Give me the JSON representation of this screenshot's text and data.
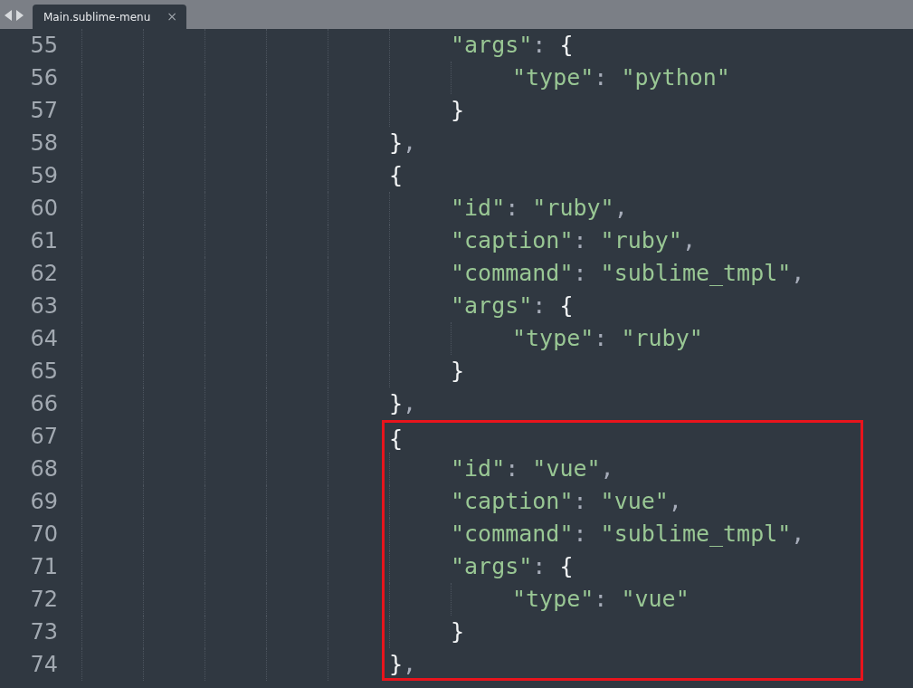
{
  "tabs": [
    {
      "title": "Main.sublime-menu",
      "close": "×",
      "selected": true
    }
  ],
  "lines": [
    {
      "children": [
        {
          "number": "55",
          "tokens": [
            {
              "kind": "string",
              "text": "\"args\""
            },
            {
              "kind": "colon",
              "text": ": "
            },
            {
              "kind": "brace",
              "text": "{"
            }
          ],
          "children": [
            {
              "number": "56",
              "tokens": [
                {
                  "kind": "string",
                  "text": "\"type\""
                },
                {
                  "kind": "colon",
                  "text": ": "
                },
                {
                  "kind": "string",
                  "text": "\"python\""
                }
              ]
            }
          ]
        },
        {
          "number": "57",
          "tokens": [
            {
              "kind": "brace",
              "text": "}"
            }
          ]
        }
      ]
    },
    {
      "number": "58",
      "tokens": [
        {
          "kind": "brace",
          "text": "}"
        },
        {
          "kind": "comma",
          "text": ","
        }
      ]
    },
    {
      "number": "59",
      "tokens": [
        {
          "kind": "brace",
          "text": "{"
        }
      ],
      "children": [
        {
          "number": "60",
          "tokens": [
            {
              "kind": "string",
              "text": "\"id\""
            },
            {
              "kind": "colon",
              "text": ": "
            },
            {
              "kind": "string",
              "text": "\"ruby\""
            },
            {
              "kind": "comma",
              "text": ","
            }
          ]
        },
        {
          "number": "61",
          "tokens": [
            {
              "kind": "string",
              "text": "\"caption\""
            },
            {
              "kind": "colon",
              "text": ": "
            },
            {
              "kind": "string",
              "text": "\"ruby\""
            },
            {
              "kind": "comma",
              "text": ","
            }
          ]
        },
        {
          "number": "62",
          "tokens": [
            {
              "kind": "string",
              "text": "\"command\""
            },
            {
              "kind": "colon",
              "text": ": "
            },
            {
              "kind": "string",
              "text": "\"sublime_tmpl\""
            },
            {
              "kind": "comma",
              "text": ","
            }
          ]
        },
        {
          "number": "63",
          "tokens": [
            {
              "kind": "string",
              "text": "\"args\""
            },
            {
              "kind": "colon",
              "text": ": "
            },
            {
              "kind": "brace",
              "text": "{"
            }
          ],
          "children": [
            {
              "number": "64",
              "tokens": [
                {
                  "kind": "string",
                  "text": "\"type\""
                },
                {
                  "kind": "colon",
                  "text": ": "
                },
                {
                  "kind": "string",
                  "text": "\"ruby\""
                }
              ]
            }
          ]
        },
        {
          "number": "65",
          "tokens": [
            {
              "kind": "brace",
              "text": "}"
            }
          ]
        }
      ]
    },
    {
      "number": "66",
      "tokens": [
        {
          "kind": "brace",
          "text": "}"
        },
        {
          "kind": "comma",
          "text": ","
        }
      ]
    },
    {
      "number": "67",
      "boxed": true,
      "tokens": [
        {
          "kind": "brace",
          "text": "{"
        }
      ],
      "children": [
        {
          "number": "68",
          "boxed": true,
          "tokens": [
            {
              "kind": "string",
              "text": "\"id\""
            },
            {
              "kind": "colon",
              "text": ": "
            },
            {
              "kind": "string",
              "text": "\"vue\""
            },
            {
              "kind": "comma",
              "text": ","
            }
          ]
        },
        {
          "number": "69",
          "boxed": true,
          "tokens": [
            {
              "kind": "string",
              "text": "\"caption\""
            },
            {
              "kind": "colon",
              "text": ": "
            },
            {
              "kind": "string",
              "text": "\"vue\""
            },
            {
              "kind": "comma",
              "text": ","
            }
          ]
        },
        {
          "number": "70",
          "boxed": true,
          "tokens": [
            {
              "kind": "string",
              "text": "\"command\""
            },
            {
              "kind": "colon",
              "text": ": "
            },
            {
              "kind": "string",
              "text": "\"sublime_tmpl\""
            },
            {
              "kind": "comma",
              "text": ","
            }
          ]
        },
        {
          "number": "71",
          "boxed": true,
          "tokens": [
            {
              "kind": "string",
              "text": "\"args\""
            },
            {
              "kind": "colon",
              "text": ": "
            },
            {
              "kind": "brace",
              "text": "{"
            }
          ],
          "children": [
            {
              "number": "72",
              "boxed": true,
              "tokens": [
                {
                  "kind": "string",
                  "text": "\"type\""
                },
                {
                  "kind": "colon",
                  "text": ": "
                },
                {
                  "kind": "string",
                  "text": "\"vue\""
                }
              ]
            }
          ]
        },
        {
          "number": "73",
          "boxed": true,
          "tokens": [
            {
              "kind": "brace",
              "text": "}"
            }
          ]
        }
      ]
    },
    {
      "number": "74",
      "boxed": true,
      "tokens": [
        {
          "kind": "brace",
          "text": "}"
        },
        {
          "kind": "comma",
          "text": ","
        }
      ]
    }
  ]
}
